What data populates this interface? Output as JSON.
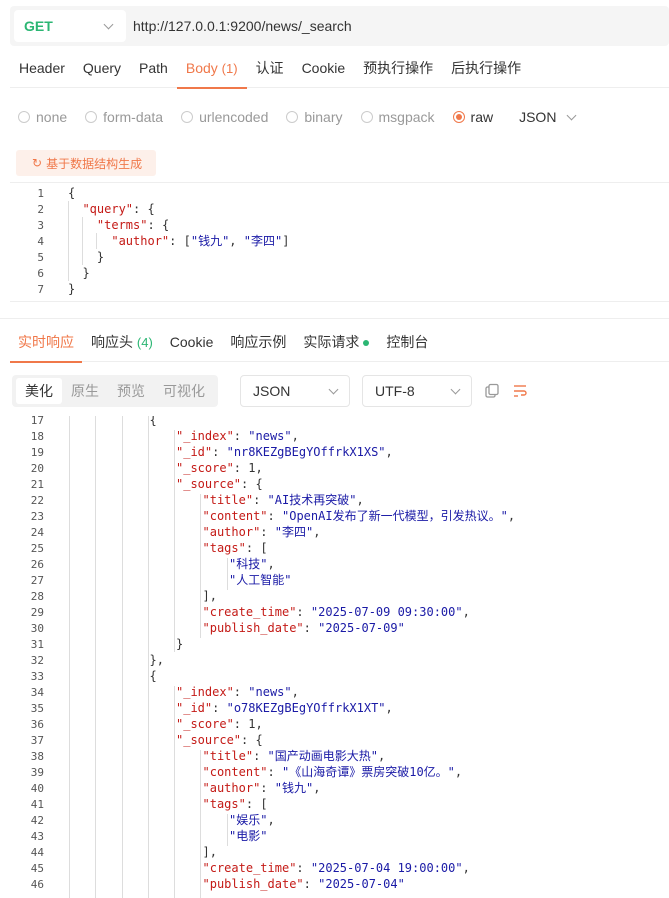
{
  "request": {
    "method": "GET",
    "url": "http://127.0.0.1:9200/news/_search"
  },
  "request_tabs": [
    {
      "label": "Header",
      "count": ""
    },
    {
      "label": "Query",
      "count": ""
    },
    {
      "label": "Path",
      "count": ""
    },
    {
      "label": "Body",
      "count": "(1)"
    },
    {
      "label": "认证",
      "count": ""
    },
    {
      "label": "Cookie",
      "count": ""
    },
    {
      "label": "预执行操作",
      "count": ""
    },
    {
      "label": "后执行操作",
      "count": ""
    }
  ],
  "body_types": [
    "none",
    "form-data",
    "urlencoded",
    "binary",
    "msgpack",
    "raw"
  ],
  "body_selected": "raw",
  "body_format": "JSON",
  "generate_button": "基于数据结构生成",
  "request_lines": [
    {
      "n": "1",
      "text": "{"
    },
    {
      "n": "2",
      "text": "  \"query\": {"
    },
    {
      "n": "3",
      "text": "    \"terms\": {"
    },
    {
      "n": "4",
      "text": "      \"author\": [\"钱九\", \"李四\"]"
    },
    {
      "n": "5",
      "text": "    }"
    },
    {
      "n": "6",
      "text": "  }"
    },
    {
      "n": "7",
      "text": "}"
    }
  ],
  "response_tabs": [
    {
      "label": "实时响应",
      "count": ""
    },
    {
      "label": "响应头",
      "count": "(4)"
    },
    {
      "label": "Cookie",
      "count": ""
    },
    {
      "label": "响应示例",
      "count": ""
    },
    {
      "label": "实际请求",
      "count": ""
    },
    {
      "label": "控制台",
      "count": ""
    }
  ],
  "view_modes": [
    "美化",
    "原生",
    "预览",
    "可视化"
  ],
  "response_format": "JSON",
  "response_encoding": "UTF-8",
  "response_lines": [
    {
      "n": "17",
      "text": "{"
    },
    {
      "n": "18",
      "text": "\"_index\": \"news\","
    },
    {
      "n": "19",
      "text": "\"_id\": \"nr8KEZgBEgYOffrkX1XS\","
    },
    {
      "n": "20",
      "text": "\"_score\": 1,"
    },
    {
      "n": "21",
      "text": "\"_source\": {"
    },
    {
      "n": "22",
      "text": "\"title\": \"AI技术再突破\","
    },
    {
      "n": "23",
      "text": "\"content\": \"OpenAI发布了新一代模型，引发热议。\","
    },
    {
      "n": "24",
      "text": "\"author\": \"李四\","
    },
    {
      "n": "25",
      "text": "\"tags\": ["
    },
    {
      "n": "26",
      "text": "\"科技\","
    },
    {
      "n": "27",
      "text": "\"人工智能\""
    },
    {
      "n": "28",
      "text": "],"
    },
    {
      "n": "29",
      "text": "\"create_time\": \"2025-07-09 09:30:00\","
    },
    {
      "n": "30",
      "text": "\"publish_date\": \"2025-07-09\""
    },
    {
      "n": "31",
      "text": "}"
    },
    {
      "n": "32",
      "text": "},"
    },
    {
      "n": "33",
      "text": "{"
    },
    {
      "n": "34",
      "text": "\"_index\": \"news\","
    },
    {
      "n": "35",
      "text": "\"_id\": \"o78KEZgBEgYOffrkX1XT\","
    },
    {
      "n": "36",
      "text": "\"_score\": 1,"
    },
    {
      "n": "37",
      "text": "\"_source\": {"
    },
    {
      "n": "38",
      "text": "\"title\": \"国产动画电影大热\","
    },
    {
      "n": "39",
      "text": "\"content\": \"《山海奇谭》票房突破10亿。\","
    },
    {
      "n": "40",
      "text": "\"author\": \"钱九\","
    },
    {
      "n": "41",
      "text": "\"tags\": ["
    },
    {
      "n": "42",
      "text": "\"娱乐\","
    },
    {
      "n": "43",
      "text": "\"电影\""
    },
    {
      "n": "44",
      "text": "],"
    },
    {
      "n": "45",
      "text": "\"create_time\": \"2025-07-04 19:00:00\","
    },
    {
      "n": "46",
      "text": "\"publish_date\": \"2025-07-04\""
    }
  ],
  "colors": {
    "accent": "#f0784a",
    "method": "#2bb673",
    "key": "#c41a16",
    "string": "#1a1aa6"
  }
}
